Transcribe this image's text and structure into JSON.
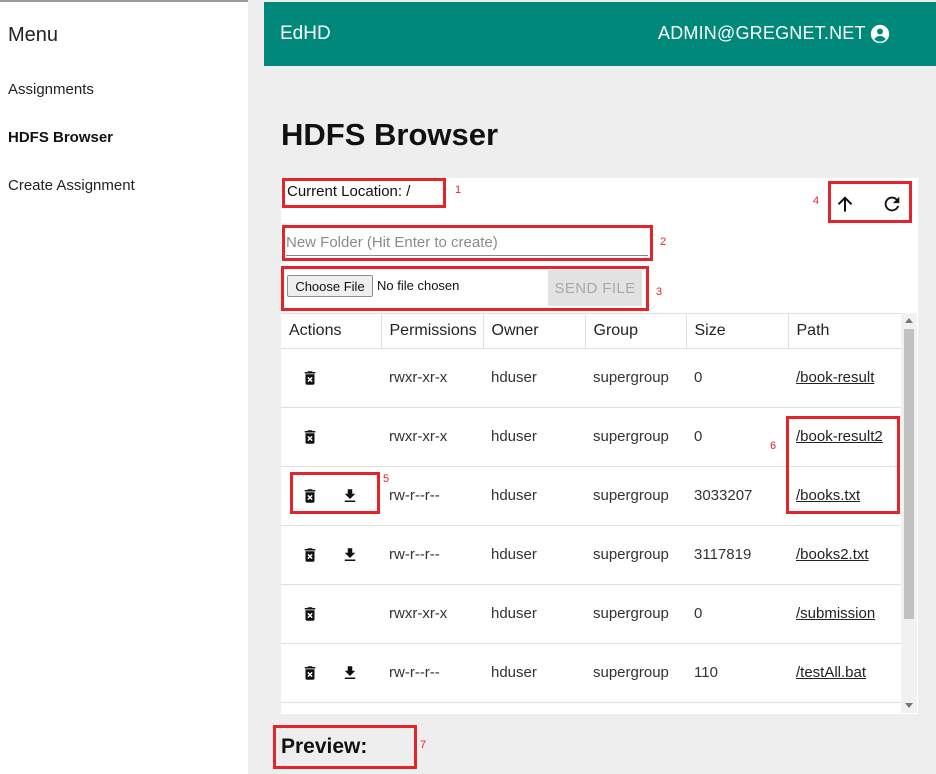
{
  "sidebar": {
    "menu_title": "Menu",
    "items": [
      {
        "label": "Assignments",
        "active": false
      },
      {
        "label": "HDFS Browser",
        "active": true
      },
      {
        "label": "Create Assignment",
        "active": false
      }
    ]
  },
  "appbar": {
    "title": "EdHD",
    "user": "ADMIN@GREGNET.NET",
    "user_icon": "account-circle-icon",
    "color": "#00897b"
  },
  "page": {
    "title": "HDFS Browser"
  },
  "browser": {
    "current_location": "Current Location: /",
    "new_folder_placeholder": "New Folder (Hit Enter to create)",
    "choose_file_label": "Choose File",
    "no_file_text": "No file chosen",
    "send_file_label": "SEND FILE",
    "toolbar": {
      "up_icon": "arrow-up-icon",
      "refresh_icon": "refresh-icon"
    }
  },
  "table": {
    "headers": [
      "Actions",
      "Permissions",
      "Owner",
      "Group",
      "Size",
      "Path"
    ],
    "rows": [
      {
        "download": false,
        "permissions": "rwxr-xr-x",
        "owner": "hduser",
        "group": "supergroup",
        "size": "0",
        "path": "/book-result"
      },
      {
        "download": false,
        "permissions": "rwxr-xr-x",
        "owner": "hduser",
        "group": "supergroup",
        "size": "0",
        "path": "/book-result2"
      },
      {
        "download": true,
        "permissions": "rw-r--r--",
        "owner": "hduser",
        "group": "supergroup",
        "size": "3033207",
        "path": "/books.txt"
      },
      {
        "download": true,
        "permissions": "rw-r--r--",
        "owner": "hduser",
        "group": "supergroup",
        "size": "3117819",
        "path": "/books2.txt"
      },
      {
        "download": false,
        "permissions": "rwxr-xr-x",
        "owner": "hduser",
        "group": "supergroup",
        "size": "0",
        "path": "/submission"
      },
      {
        "download": true,
        "permissions": "rw-r--r--",
        "owner": "hduser",
        "group": "supergroup",
        "size": "110",
        "path": "/testAll.bat"
      }
    ]
  },
  "preview": {
    "label": "Preview:"
  },
  "annotations": {
    "color": "#e3242b",
    "labels": [
      "1",
      "2",
      "3",
      "4",
      "5",
      "6",
      "7"
    ]
  }
}
